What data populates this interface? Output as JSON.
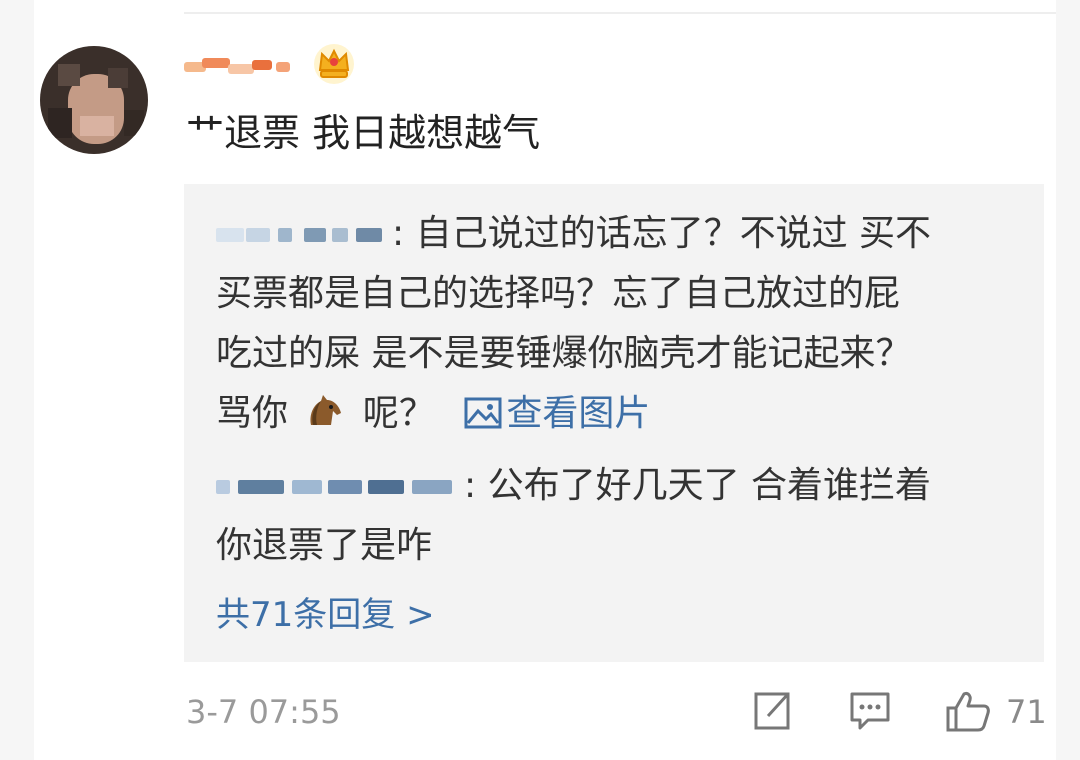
{
  "comment": {
    "text": "艹退票 我日越想越气",
    "timestamp": "3-7 07:55",
    "like_count": "71"
  },
  "replies": [
    {
      "line1": ": 自己说过的话忘了？不说过 买不",
      "line2": "买票都是自己的选择吗？忘了自己放过的屁",
      "line3": "吃过的屎 是不是要锤爆你脑壳才能记起来？",
      "line4_before": "骂你",
      "line4_after": "呢？",
      "image_link": "查看图片"
    },
    {
      "line1": ": 公布了好几天了 合着谁拦着",
      "line2": "你退票了是咋"
    }
  ],
  "more_replies": "共71条回复 >",
  "icons": {
    "crown": "crown-icon",
    "horse": "horse-emoji-icon",
    "image": "image-icon",
    "share": "share-icon",
    "comment": "comment-icon",
    "like": "thumbs-up-icon"
  },
  "colors": {
    "link": "#3d6fa7",
    "text": "#222222",
    "muted": "#9a9a9a",
    "reply_bg": "#f3f3f3"
  }
}
